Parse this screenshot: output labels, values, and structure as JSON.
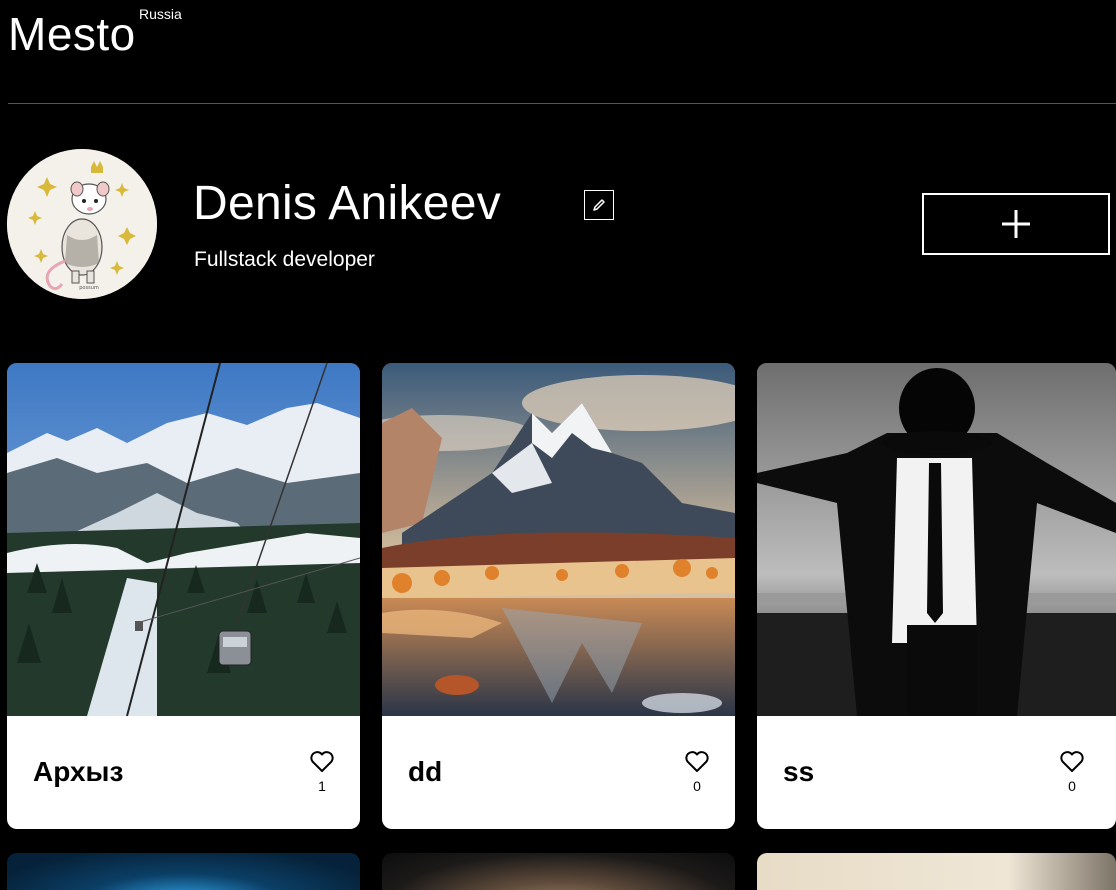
{
  "header": {
    "logo": "Mesto",
    "logo_superscript": "Russia"
  },
  "profile": {
    "name": "Denis Anikeev",
    "job": "Fullstack developer",
    "avatar_icon": "opossum-avatar",
    "edit_icon": "pencil-icon",
    "add_icon": "plus-icon"
  },
  "cards": [
    {
      "title": "Архыз",
      "likes": "1",
      "image": "mountain-cable-car-photo"
    },
    {
      "title": "dd",
      "likes": "0",
      "image": "mountain-lake-sunset-photo"
    },
    {
      "title": "ss",
      "likes": "0",
      "image": "man-in-hat-bw-photo"
    }
  ],
  "colors": {
    "background": "#000000",
    "card": "#ffffff",
    "text_on_dark": "#ffffff",
    "text_on_card": "#000000",
    "divider": "#545454"
  }
}
